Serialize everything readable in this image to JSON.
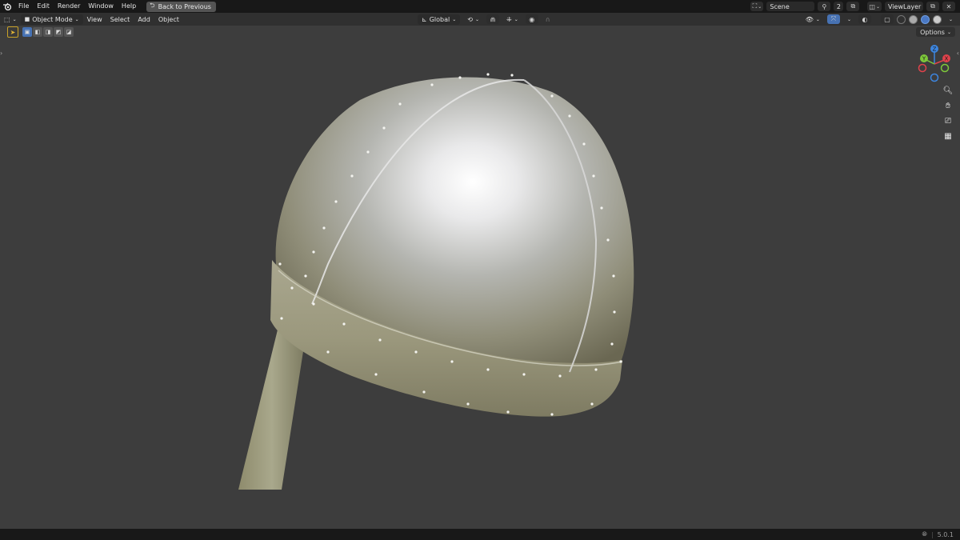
{
  "topbar": {
    "menus": [
      "File",
      "Edit",
      "Render",
      "Window",
      "Help"
    ],
    "back_label": "Back to Previous",
    "scene_name": "Scene",
    "scene_users": "2",
    "view_layer": "ViewLayer"
  },
  "header": {
    "mode_label": "Object Mode",
    "menus": [
      "View",
      "Select",
      "Add",
      "Object"
    ],
    "orientation": "Global",
    "options_label": "Options"
  },
  "gizmo": {
    "axis_z": "Z",
    "axis_y": "Y",
    "axis_x": "X",
    "colors": {
      "x": "#e0424b",
      "y": "#7ec93a",
      "z": "#3d86e0"
    }
  },
  "status": {
    "version": "5.0.1"
  },
  "colors": {
    "viewport_bg": "#3d3d3d",
    "accent": "#4772b3",
    "active_tool": "#c9a227"
  }
}
